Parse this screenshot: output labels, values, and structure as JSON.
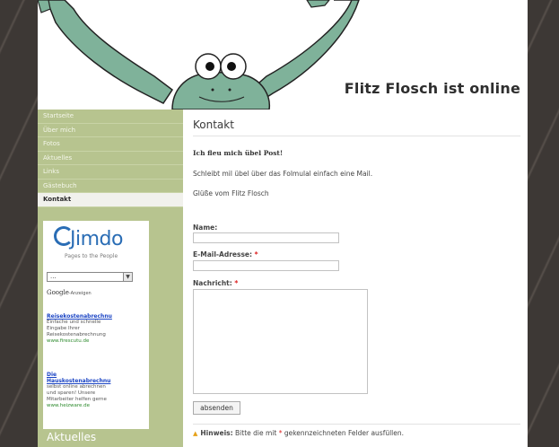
{
  "header": {
    "site_title": "Flitz Flosch ist online"
  },
  "sidebar": {
    "nav": [
      {
        "label": "Startseite",
        "active": false
      },
      {
        "label": "Über mich",
        "active": false
      },
      {
        "label": "Fotos",
        "active": false
      },
      {
        "label": "Aktuelles",
        "active": false
      },
      {
        "label": "Links",
        "active": false
      },
      {
        "label": "Gästebuch",
        "active": false
      },
      {
        "label": "Kontakt",
        "active": true
      }
    ],
    "widget": {
      "logo_word": "Jimdo",
      "logo_tagline": "Pages to the People",
      "select_value": "...",
      "google_brand": "Google",
      "google_suffix": "-Anzeigen",
      "ads": [
        {
          "title": "Reisekostenabrechnu",
          "lines": [
            "Einfache und schnelle",
            "Eingabe Ihrer",
            "Reisekostenabrechnung"
          ],
          "url": "www.firescutu.de"
        },
        {
          "title_lines": [
            "Die",
            "Hauskostenabrechnu"
          ],
          "lines": [
            "selbst online abrechnen",
            "und sparen! Unsere",
            "Mitarbeiter helfen gerne"
          ],
          "url": "www.heizware.de"
        }
      ]
    },
    "section_heading": "Aktuelles"
  },
  "content": {
    "page_title": "Kontakt",
    "heading": "Ich fleu mich übel Post!",
    "paragraph1": "Schleibt mil übel über das Folmulal einfach eine Mail.",
    "paragraph2": "Glüße vom Flitz Flosch",
    "form": {
      "name_label": "Name:",
      "email_label": "E-Mail-Adresse:",
      "message_label": "Nachricht:",
      "required_marker": "*",
      "submit_label": "absenden"
    },
    "note": {
      "bold": "Hinweis:",
      "text_before": "Bitte die mit",
      "marker": "*",
      "text_after": "gekennzeichneten Felder ausfüllen."
    }
  },
  "colors": {
    "sidebar_green": "#b7c48f",
    "frog_green": "#7fb29a",
    "required_red": "#dd2222",
    "link_blue": "#1a44c4"
  }
}
